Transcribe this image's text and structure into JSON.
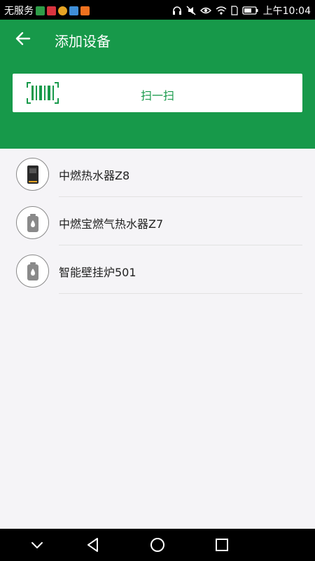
{
  "status_bar": {
    "carrier": "无服务",
    "time": "上午10:04",
    "app_icon_colors": [
      "#2e9c48",
      "#d8343f",
      "#e5a424",
      "#3f8fd8",
      "#f0721f"
    ]
  },
  "header": {
    "title": "添加设备",
    "back_icon": "arrow-left-icon"
  },
  "scan": {
    "label": "扫一扫",
    "icon": "barcode-scan-icon"
  },
  "devices": [
    {
      "label": "中燃热水器Z8",
      "icon": "water-heater-icon"
    },
    {
      "label": "中燃宝燃气热水器Z7",
      "icon": "gas-water-heater-icon"
    },
    {
      "label": "智能壁挂炉501",
      "icon": "wall-boiler-icon"
    }
  ],
  "colors": {
    "brand_green": "#17994a",
    "background": "#f5f4f7"
  }
}
